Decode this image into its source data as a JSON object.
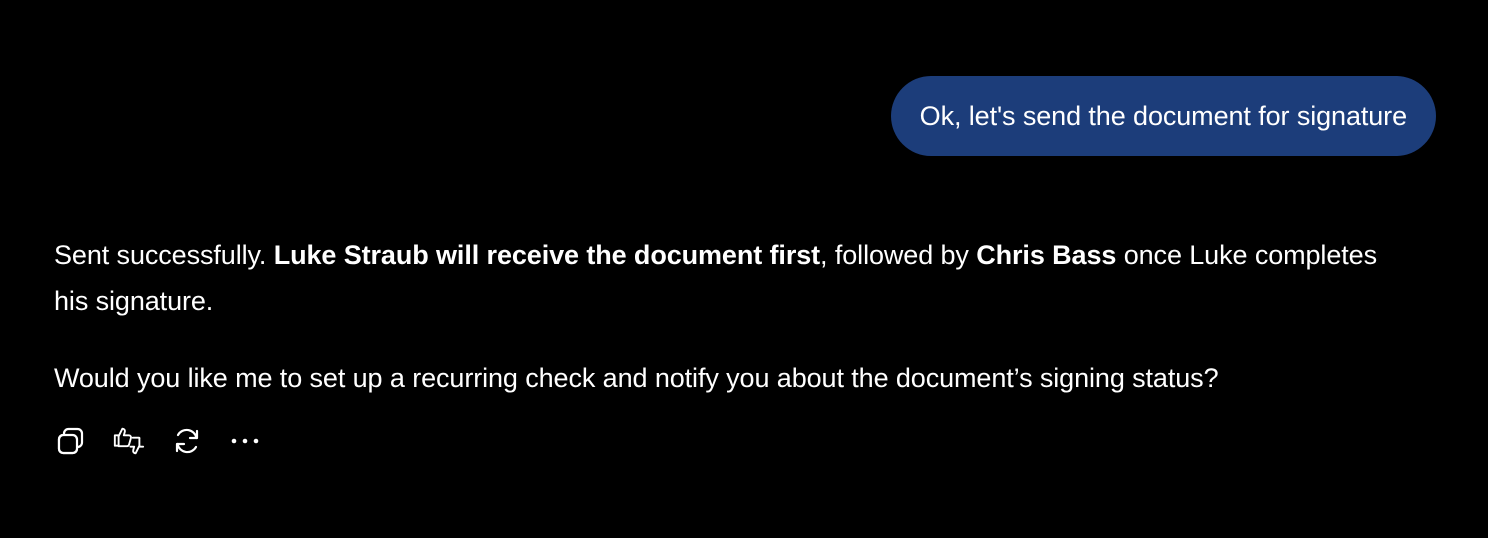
{
  "user_message": {
    "text": "Ok, let's send the document for signature"
  },
  "assistant_message": {
    "paragraph1": {
      "part1": "Sent successfully. ",
      "bold1": "Luke Straub will receive the document first",
      "part2": ", followed by ",
      "bold2": "Chris Bass",
      "part3": " once Luke completes his signature."
    },
    "paragraph2": "Would you like me to set up a recurring check and notify you about the document’s signing status?"
  },
  "actions": {
    "icons": [
      "copy-icon",
      "thumbs-up-down-icon",
      "refresh-icon",
      "more-icon"
    ]
  },
  "colors": {
    "background": "#000000",
    "user_bubble": "#1c3d7a",
    "text": "#ffffff"
  }
}
